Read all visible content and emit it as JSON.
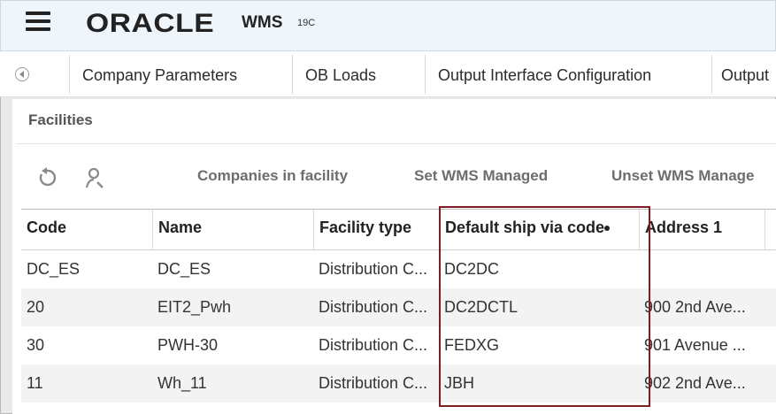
{
  "header": {
    "brand": "ORACLE",
    "app_name": "WMS",
    "version": "19C"
  },
  "tabs": [
    {
      "label": "Company Parameters"
    },
    {
      "label": "OB Loads"
    },
    {
      "label": "Output Interface Configuration"
    },
    {
      "label": "Output"
    }
  ],
  "panel": {
    "title": "Facilities",
    "actions": [
      {
        "label": "Companies in facility"
      },
      {
        "label": "Set WMS Managed"
      },
      {
        "label": "Unset WMS Manage"
      }
    ]
  },
  "table": {
    "columns": [
      "Code",
      "Name",
      "Facility type",
      "Default ship via code",
      "Address 1"
    ],
    "rows": [
      {
        "code": "DC_ES",
        "name": "DC_ES",
        "type": "Distribution C...",
        "ship_via": "DC2DC",
        "address": ""
      },
      {
        "code": "20",
        "name": "EIT2_Pwh",
        "type": "Distribution C...",
        "ship_via": "DC2DCTL",
        "address": "900 2nd Ave..."
      },
      {
        "code": "30",
        "name": "PWH-30",
        "type": "Distribution C...",
        "ship_via": "FEDXG",
        "address": "901 Avenue ..."
      },
      {
        "code": "11",
        "name": "Wh_11",
        "type": "Distribution C...",
        "ship_via": "JBH",
        "address": "902 2nd Ave..."
      }
    ]
  }
}
